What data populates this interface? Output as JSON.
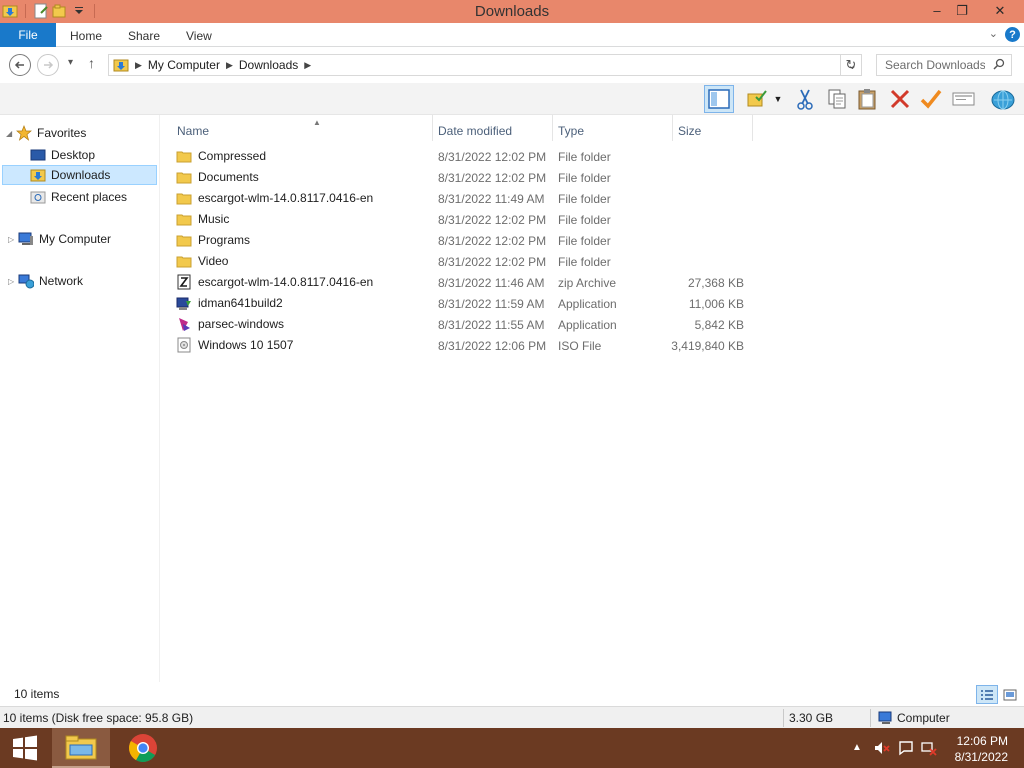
{
  "window": {
    "title": "Downloads",
    "controls": {
      "minimize": "–",
      "maximize": "❐",
      "close": "✕"
    }
  },
  "ribbon": {
    "tabs": [
      {
        "label": "File"
      },
      {
        "label": "Home"
      },
      {
        "label": "Share"
      },
      {
        "label": "View"
      }
    ],
    "help": "?"
  },
  "address": {
    "breadcrumbs": [
      "My Computer",
      "Downloads"
    ],
    "search_placeholder": "Search Downloads"
  },
  "nav": {
    "favorites_label": "Favorites",
    "favorites": [
      {
        "label": "Desktop"
      },
      {
        "label": "Downloads",
        "selected": true
      },
      {
        "label": "Recent places"
      }
    ],
    "computer_label": "My Computer",
    "network_label": "Network"
  },
  "columns": {
    "name": "Name",
    "date": "Date modified",
    "type": "Type",
    "size": "Size"
  },
  "files": [
    {
      "name": "Compressed",
      "date": "8/31/2022 12:02 PM",
      "type": "File folder",
      "size": "",
      "icon": "folder-icon"
    },
    {
      "name": "Documents",
      "date": "8/31/2022 12:02 PM",
      "type": "File folder",
      "size": "",
      "icon": "folder-icon"
    },
    {
      "name": "escargot-wlm-14.0.8117.0416-en",
      "date": "8/31/2022 11:49 AM",
      "type": "File folder",
      "size": "",
      "icon": "folder-icon"
    },
    {
      "name": "Music",
      "date": "8/31/2022 12:02 PM",
      "type": "File folder",
      "size": "",
      "icon": "folder-icon"
    },
    {
      "name": "Programs",
      "date": "8/31/2022 12:02 PM",
      "type": "File folder",
      "size": "",
      "icon": "folder-icon"
    },
    {
      "name": "Video",
      "date": "8/31/2022 12:02 PM",
      "type": "File folder",
      "size": "",
      "icon": "folder-icon"
    },
    {
      "name": "escargot-wlm-14.0.8117.0416-en",
      "date": "8/31/2022 11:46 AM",
      "type": "zip Archive",
      "size": "27,368 KB",
      "icon": "zip-archive-icon"
    },
    {
      "name": "idman641build2",
      "date": "8/31/2022 11:59 AM",
      "type": "Application",
      "size": "11,006 KB",
      "icon": "installer-icon"
    },
    {
      "name": "parsec-windows",
      "date": "8/31/2022 11:55 AM",
      "type": "Application",
      "size": "5,842 KB",
      "icon": "parsec-app-icon"
    },
    {
      "name": "Windows 10 1507",
      "date": "8/31/2022 12:06 PM",
      "type": "ISO File",
      "size": "3,419,840 KB",
      "icon": "iso-file-icon"
    }
  ],
  "status": {
    "item_count": "10 items",
    "details": "10 items (Disk free space: 95.8 GB)",
    "selection_size": "3.30 GB",
    "location": "Computer"
  },
  "taskbar": {
    "time": "12:06 PM",
    "date": "8/31/2022"
  },
  "colors": {
    "titlebar": "#e8876b",
    "file_tab": "#1979ca",
    "taskbar": "#6b3a22",
    "selected": "#cce8ff"
  }
}
